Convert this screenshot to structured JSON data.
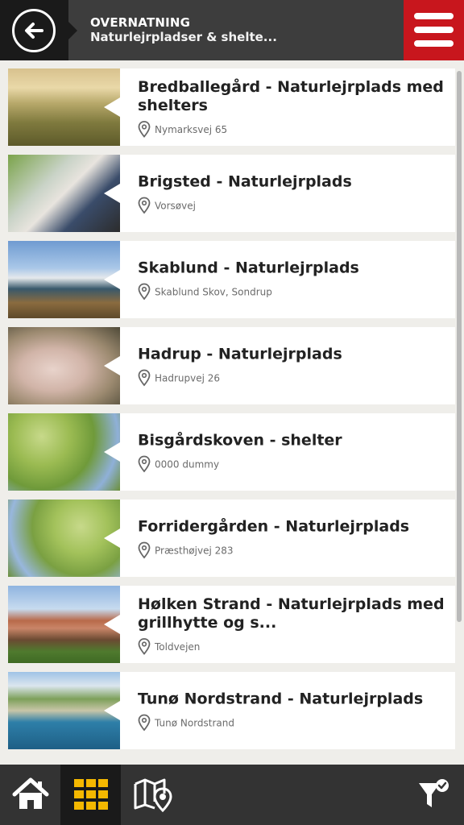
{
  "header": {
    "title": "OVERNATNING",
    "subtitle": "Naturlejrpladser & shelte..."
  },
  "items": [
    {
      "title": "Bredballegård - Naturlejrplads med shelters",
      "address": "Nymarksvej 65"
    },
    {
      "title": "Brigsted - Naturlejrplads",
      "address": "Vorsøvej"
    },
    {
      "title": "Skablund - Naturlejrplads",
      "address": "Skablund Skov, Sondrup"
    },
    {
      "title": "Hadrup - Naturlejrplads",
      "address": "Hadrupvej 26"
    },
    {
      "title": "Bisgårdskoven - shelter",
      "address": "0000 dummy"
    },
    {
      "title": "Forridergården - Naturlejrplads",
      "address": "Præsthøjvej 283"
    },
    {
      "title": "Hølken Strand - Naturlejrplads med grillhytte og s...",
      "address": "Toldvejen"
    },
    {
      "title": "Tunø Nordstrand - Naturlejrplads",
      "address": "Tunø Nordstrand"
    }
  ],
  "colors": {
    "menu_red": "#c8161d",
    "active_tab_icon": "#f5b800"
  },
  "nav_icons": [
    "home-icon",
    "grid-icon",
    "map-icon",
    "filter-icon"
  ]
}
